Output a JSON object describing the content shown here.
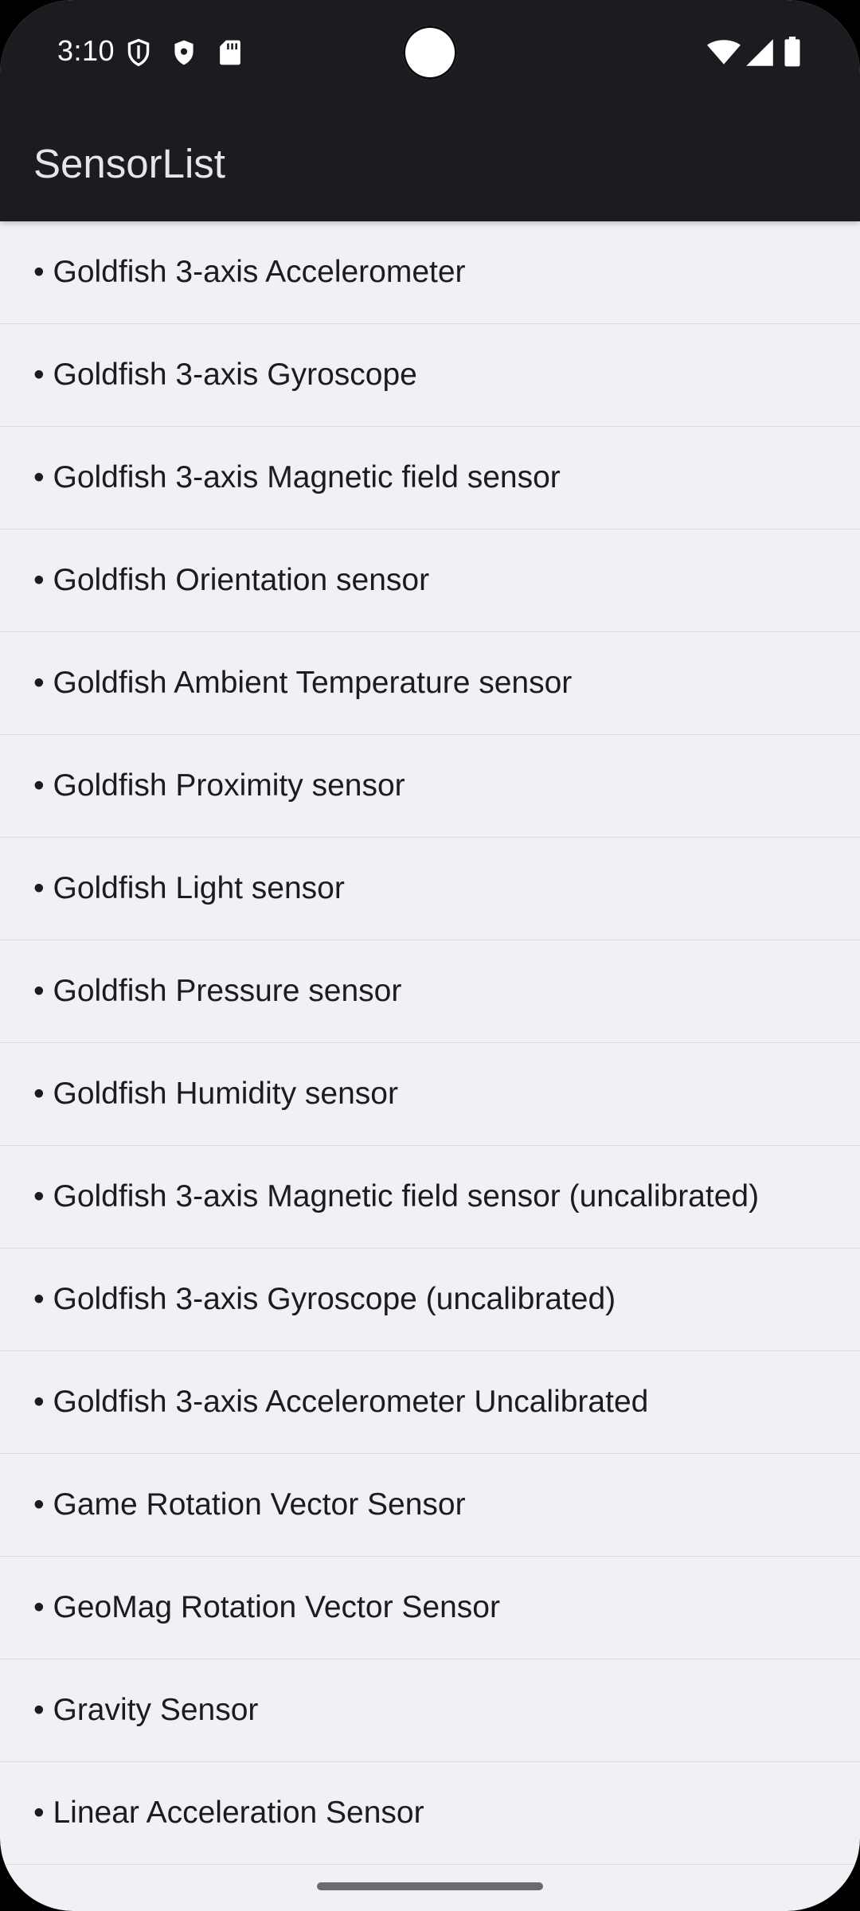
{
  "status_bar": {
    "time": "3:10",
    "icons_left": [
      "shield-outline-icon",
      "shield-filled-icon",
      "sd-card-icon"
    ],
    "icons_right": [
      "wifi-icon",
      "cell-signal-icon",
      "battery-icon"
    ]
  },
  "app_bar": {
    "title": "SensorList"
  },
  "sensors": [
    "• Goldfish 3-axis Accelerometer",
    "• Goldfish 3-axis Gyroscope",
    "• Goldfish 3-axis Magnetic field sensor",
    "• Goldfish Orientation sensor",
    "• Goldfish Ambient Temperature sensor",
    "• Goldfish Proximity sensor",
    "• Goldfish Light sensor",
    "• Goldfish Pressure sensor",
    "• Goldfish Humidity sensor",
    "• Goldfish 3-axis Magnetic field sensor (uncalibrated)",
    "• Goldfish 3-axis Gyroscope (uncalibrated)",
    "• Goldfish 3-axis Accelerometer Uncalibrated",
    "• Game Rotation Vector Sensor",
    "• GeoMag Rotation Vector Sensor",
    "• Gravity Sensor",
    "• Linear Acceleration Sensor"
  ],
  "colors": {
    "bar_background": "#1c1b20",
    "list_background": "#f1f0f5",
    "divider": "#dcdbe1",
    "text": "#1b1b20",
    "title_text": "#e7e4ec"
  }
}
